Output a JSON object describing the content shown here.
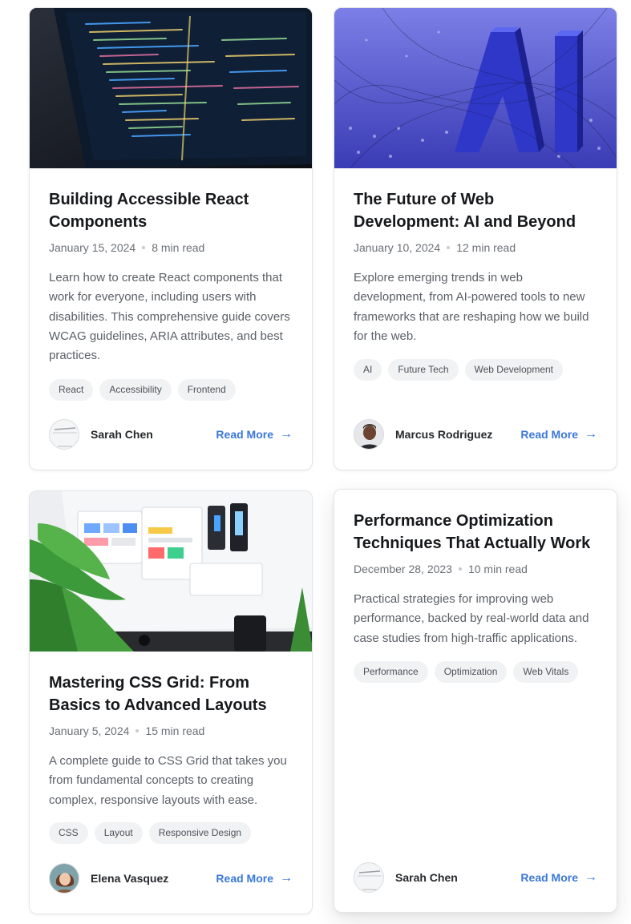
{
  "posts": [
    {
      "title": "Building Accessible React Components",
      "date": "January 15, 2024",
      "read_time": "8 min read",
      "excerpt": "Learn how to create React components that work for everyone, including users with disabilities. This comprehensive guide covers WCAG guidelines, ARIA attributes, and best practices.",
      "tags": [
        "React",
        "Accessibility",
        "Frontend"
      ],
      "author": "Sarah Chen",
      "read_more": "Read More",
      "arrow": "→"
    },
    {
      "title": "The Future of Web Development: AI and Beyond",
      "date": "January 10, 2024",
      "read_time": "12 min read",
      "excerpt": "Explore emerging trends in web development, from AI-powered tools to new frameworks that are reshaping how we build for the web.",
      "tags": [
        "AI",
        "Future Tech",
        "Web Development"
      ],
      "author": "Marcus Rodriguez",
      "read_more": "Read More",
      "arrow": "→"
    },
    {
      "title": "Mastering CSS Grid: From Basics to Advanced Layouts",
      "date": "January 5, 2024",
      "read_time": "15 min read",
      "excerpt": "A complete guide to CSS Grid that takes you from fundamental concepts to creating complex, responsive layouts with ease.",
      "tags": [
        "CSS",
        "Layout",
        "Responsive Design"
      ],
      "author": "Elena Vasquez",
      "read_more": "Read More",
      "arrow": "→"
    },
    {
      "title": "Performance Optimization Techniques That Actually Work",
      "date": "December 28, 2023",
      "read_time": "10 min read",
      "excerpt": "Practical strategies for improving web performance, backed by real-world data and case studies from high-traffic applications.",
      "tags": [
        "Performance",
        "Optimization",
        "Web Vitals"
      ],
      "author": "Sarah Chen",
      "read_more": "Read More",
      "arrow": "→"
    }
  ],
  "colors": {
    "accent": "#3a78d8",
    "tag_bg": "#f1f2f4",
    "text_muted": "#6b7076"
  }
}
